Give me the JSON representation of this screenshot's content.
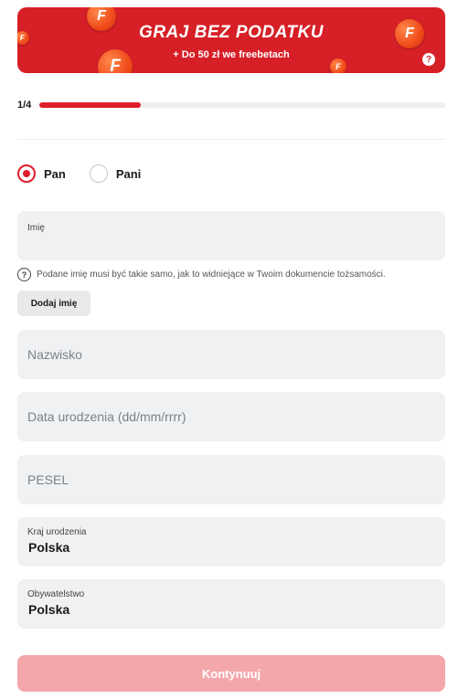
{
  "banner": {
    "title": "GRAJ BEZ PODATKU",
    "subtitle": "+ Do 50 zł we freebetach",
    "coin_glyph": "F",
    "help_glyph": "?",
    "background_color": "#d61f26",
    "coin_icon": "coin-f-icon",
    "help_icon": "help-circle-icon"
  },
  "progress": {
    "step_label": "1/4",
    "fraction": 0.25,
    "accent_color": "#e01e2b"
  },
  "gender": {
    "options": [
      {
        "label": "Pan",
        "checked": true
      },
      {
        "label": "Pani",
        "checked": false
      }
    ]
  },
  "first_name": {
    "label": "Imię",
    "hint_icon_glyph": "?",
    "hint_text": "Podane imię musi być takie samo, jak to widniejące w Twoim dokumencie tożsamości.",
    "add_button_label": "Dodaj imię"
  },
  "last_name": {
    "placeholder": "Nazwisko"
  },
  "birth_date": {
    "placeholder": "Data urodzenia (dd/mm/rrrr)"
  },
  "pesel": {
    "placeholder": "PESEL"
  },
  "birth_country": {
    "label": "Kraj urodzenia",
    "value": "Polska"
  },
  "citizenship": {
    "label": "Obywatelstwo",
    "value": "Polska"
  },
  "submit": {
    "label": "Kontynuuj",
    "color": "#f4a7ab"
  }
}
